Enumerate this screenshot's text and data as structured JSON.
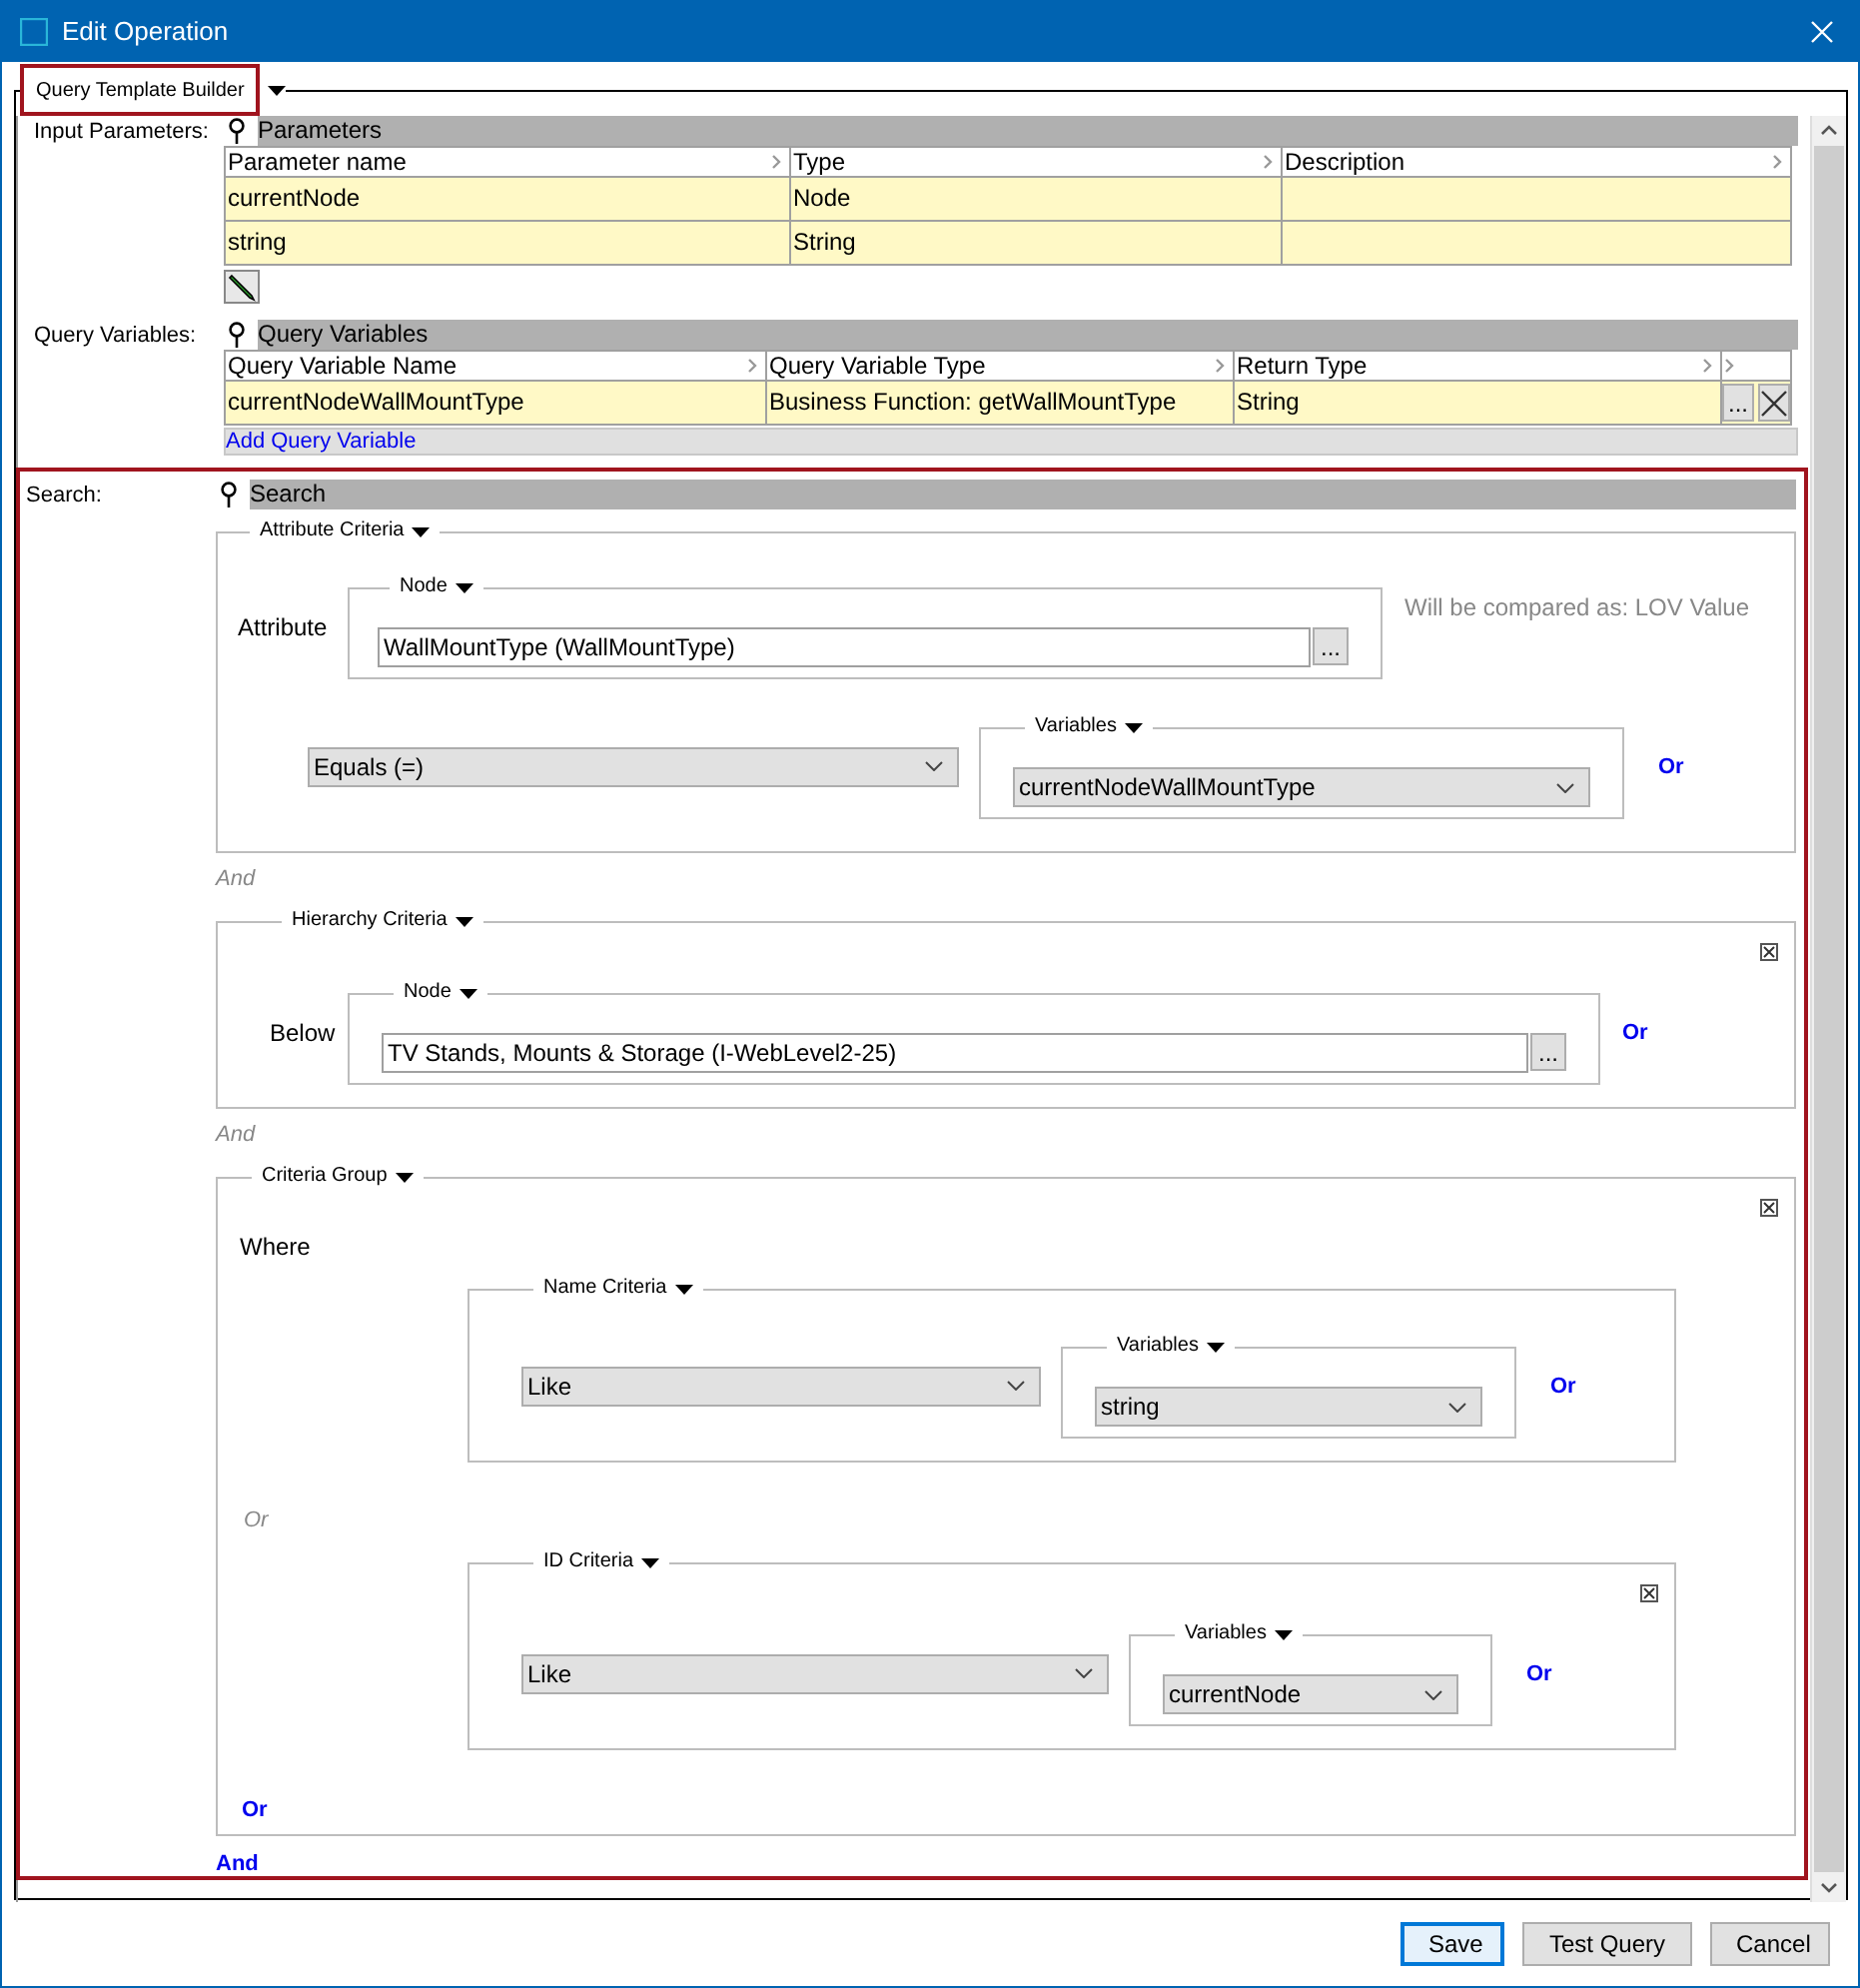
{
  "window": {
    "title": "Edit Operation"
  },
  "builder": {
    "title": "Query Template Builder",
    "highlighted": true
  },
  "parameters": {
    "label": "Input Parameters:",
    "header": "Parameters",
    "columns": [
      "Parameter name",
      "Type",
      "Description"
    ],
    "rows": [
      {
        "name": "currentNode",
        "type": "Node"
      },
      {
        "name": "string",
        "type": "String"
      }
    ]
  },
  "query_variables": {
    "label": "Query Variables:",
    "header": "Query Variables",
    "columns": [
      "Query Variable Name",
      "Query Variable Type",
      "Return Type"
    ],
    "rows": [
      {
        "name": "currentNodeWallMountType",
        "type": "Business Function: getWallMountType",
        "return_type": "String",
        "browse": "..."
      }
    ],
    "add_link": "Add Query Variable"
  },
  "search": {
    "label": "Search:",
    "header": "Search",
    "highlighted": true,
    "items": [
      {
        "kind": "attribute",
        "title": "Attribute Criteria",
        "closable": false,
        "label": "Attribute",
        "node": {
          "title": "Node",
          "value": "WallMountType (WallMountType)",
          "browse": "..."
        },
        "note": "Will be compared as: LOV Value",
        "operator": "Equals (=)",
        "variables": {
          "title": "Variables",
          "value": "currentNodeWallMountType"
        },
        "or_link": "Or"
      },
      {
        "kind": "separator",
        "text": "And"
      },
      {
        "kind": "hierarchy",
        "title": "Hierarchy Criteria",
        "closable": true,
        "label": "Below",
        "node": {
          "title": "Node",
          "value": "TV Stands, Mounts & Storage (I-WebLevel2-25)",
          "browse": "..."
        },
        "or_link": "Or"
      },
      {
        "kind": "separator",
        "text": "And"
      },
      {
        "kind": "group",
        "title": "Criteria Group",
        "closable": true,
        "label": "Where",
        "or_link": "Or",
        "children": [
          {
            "kind": "criteria",
            "title": "Name Criteria",
            "closable": false,
            "operator": "Like",
            "variables": {
              "title": "Variables",
              "value": "string"
            },
            "or_link": "Or"
          },
          {
            "kind": "separator",
            "text": "Or"
          },
          {
            "kind": "criteria",
            "title": "ID Criteria",
            "closable": true,
            "operator": "Like",
            "variables": {
              "title": "Variables",
              "value": "currentNode"
            },
            "or_link": "Or"
          }
        ]
      },
      {
        "kind": "link",
        "text": "And"
      }
    ]
  },
  "buttons": [
    {
      "label": "Save",
      "focused": true
    },
    {
      "label": "Test Query",
      "focused": false
    },
    {
      "label": "Cancel",
      "focused": false
    }
  ]
}
